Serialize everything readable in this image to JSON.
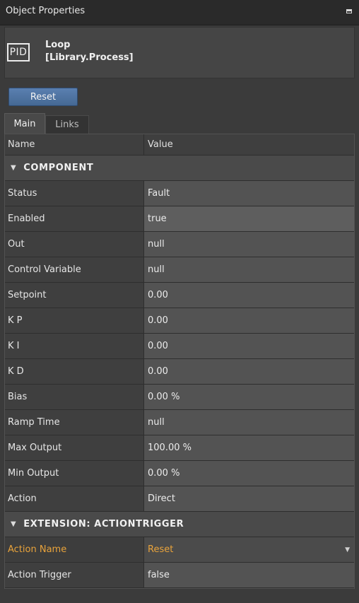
{
  "panel": {
    "title": "Object Properties"
  },
  "object": {
    "icon_text": "PID",
    "name": "Loop",
    "type": "[Library.Process]"
  },
  "actions": {
    "reset_label": "Reset"
  },
  "tabs": [
    {
      "label": "Main",
      "active": true
    },
    {
      "label": "Links",
      "active": false
    }
  ],
  "grid": {
    "columns": {
      "name": "Name",
      "value": "Value"
    },
    "sections": [
      {
        "title": "COMPONENT",
        "rows": [
          {
            "name": "Status",
            "value": "Fault"
          },
          {
            "name": "Enabled",
            "value": "true"
          },
          {
            "name": "Out",
            "value": "null"
          },
          {
            "name": "Control Variable",
            "value": "null"
          },
          {
            "name": "Setpoint",
            "value": "0.00"
          },
          {
            "name": "K P",
            "value": "0.00"
          },
          {
            "name": "K I",
            "value": "0.00"
          },
          {
            "name": "K D",
            "value": "0.00"
          },
          {
            "name": "Bias",
            "value": "0.00 %"
          },
          {
            "name": "Ramp Time",
            "value": "null"
          },
          {
            "name": "Max Output",
            "value": "100.00 %"
          },
          {
            "name": "Min Output",
            "value": "0.00 %"
          },
          {
            "name": "Action",
            "value": "Direct"
          }
        ]
      },
      {
        "title": "EXTENSION: ACTIONTRIGGER",
        "rows": [
          {
            "name": "Action Name",
            "value": "Reset"
          },
          {
            "name": "Action Trigger",
            "value": "false"
          }
        ]
      }
    ]
  },
  "colors": {
    "accent_orange": "#e9a33b",
    "button_blue": "#4f75a6"
  }
}
